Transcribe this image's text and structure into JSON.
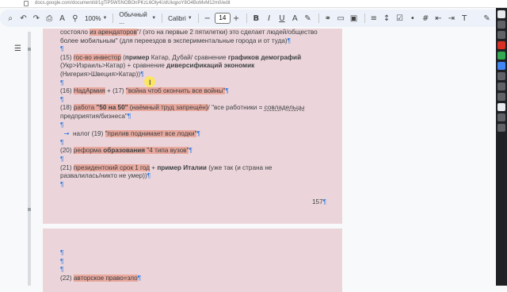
{
  "browser": {
    "url": "docs.google.com/document/d/1gTiP5WSNOBOnPKzL6Oly4UdUkqpoY8O4BoMvM12m0/edit"
  },
  "toolbar": {
    "zoom": "100%",
    "style": "Обычный ...",
    "font": "Calibri",
    "font_size": "14"
  },
  "page1": {
    "lines": [
      {
        "segments": [
          {
            "t": "состояло "
          },
          {
            "t": "из арендаторов",
            "hl": 1
          },
          {
            "t": "\"/ (это на первые 2 пятилетки) это сделает людей/общество"
          }
        ]
      },
      {
        "segments": [
          {
            "t": "более мобильным\" (для переездов в экспериментальные города и от туда)"
          },
          {
            "t": "¶",
            "pm": 1
          }
        ]
      },
      {
        "segments": [
          {
            "t": "¶",
            "pm": 1
          }
        ]
      },
      {
        "segments": [
          {
            "t": "(15) "
          },
          {
            "t": "гос-во инвестор",
            "hl": 1
          },
          {
            "t": " (",
            "b": 0
          },
          {
            "t": "пример",
            "b": 1
          },
          {
            "t": " Катар, Дубай/ сравнение "
          },
          {
            "t": "графиков демографий",
            "b": 1
          }
        ]
      },
      {
        "segments": [
          {
            "t": "(Укр>Израиль>Катар) + сравнение "
          },
          {
            "t": "диверсификаций экономик",
            "b": 1
          }
        ]
      },
      {
        "segments": [
          {
            "t": "(Нигерия>Швеция>Катар))"
          },
          {
            "t": "¶",
            "pm": 1
          }
        ]
      },
      {
        "segments": [
          {
            "t": "¶",
            "pm": 1
          }
        ]
      },
      {
        "segments": [
          {
            "t": "(16) "
          },
          {
            "t": "НадАрмия",
            "hl": 1
          },
          {
            "t": " + (17) "
          },
          {
            "t": "\"война чтоб окончить все войны\"",
            "hl": 1
          },
          {
            "t": "¶",
            "pm": 1
          }
        ]
      },
      {
        "segments": [
          {
            "t": "¶",
            "pm": 1
          }
        ]
      },
      {
        "segments": [
          {
            "t": "(18) "
          },
          {
            "t": "работа ",
            "hl": 1
          },
          {
            "t": "\"50 на 50\"",
            "hl": 1,
            "b": 1
          },
          {
            "t": " (наёмный труд запрещён)",
            "hl": 1
          },
          {
            "t": "/ \"все работники = "
          },
          {
            "t": "совладельцы",
            "u": 1
          }
        ]
      },
      {
        "segments": [
          {
            "t": "предприятия/бизнеса\""
          },
          {
            "t": "¶",
            "pm": 1
          }
        ]
      },
      {
        "segments": [
          {
            "t": "¶",
            "pm": 1
          }
        ]
      },
      {
        "segments": [
          {
            "t": "→",
            "arrow": 1
          },
          {
            "t": "налог (19) "
          },
          {
            "t": "\"прилив поднимает все лодки\"",
            "hl": 1
          },
          {
            "t": "¶",
            "pm": 1
          }
        ]
      },
      {
        "segments": [
          {
            "t": "¶",
            "pm": 1
          }
        ]
      },
      {
        "segments": [
          {
            "t": "(20) "
          },
          {
            "t": "реформа ",
            "hl": 1
          },
          {
            "t": "образования",
            "hl": 1,
            "b": 1
          },
          {
            "t": " \"4 типа вузов\"",
            "hl": 1
          },
          {
            "t": "¶",
            "pm": 1
          }
        ]
      },
      {
        "segments": [
          {
            "t": "¶",
            "pm": 1
          }
        ]
      },
      {
        "segments": [
          {
            "t": "(21) "
          },
          {
            "t": "президентский срок 1 год",
            "hl": 1
          },
          {
            "t": " + "
          },
          {
            "t": "пример Италии",
            "b": 1
          },
          {
            "t": " (уже так (и страна не"
          }
        ]
      },
      {
        "segments": [
          {
            "t": "развалилась/никто не умер))"
          },
          {
            "t": "¶",
            "pm": 1
          }
        ]
      },
      {
        "segments": [
          {
            "t": "¶",
            "pm": 1
          }
        ]
      }
    ],
    "page_number": "157",
    "page_number_mark": "¶"
  },
  "page2": {
    "lines": [
      {
        "segments": [
          {
            "t": "¶",
            "pm": 1
          }
        ]
      },
      {
        "segments": [
          {
            "t": "¶",
            "pm": 1
          }
        ]
      },
      {
        "segments": [
          {
            "t": "¶",
            "pm": 1
          }
        ]
      },
      {
        "segments": [
          {
            "t": "(22) "
          },
          {
            "t": "авторское право=зло",
            "hl": 1
          },
          {
            "t": "¶",
            "pm": 1
          }
        ]
      }
    ]
  },
  "icons": [
    "search-icon",
    "undo-icon",
    "redo-icon",
    "print-icon",
    "spellcheck-icon",
    "paint-format-icon",
    "outline-icon",
    "edit-pencil-icon"
  ],
  "colors": {
    "page_bg": "#ecd5da",
    "highlight": "#e9a99e",
    "toolbar_bg": "#edf2fa",
    "pilcrow": "#1a73e8"
  }
}
